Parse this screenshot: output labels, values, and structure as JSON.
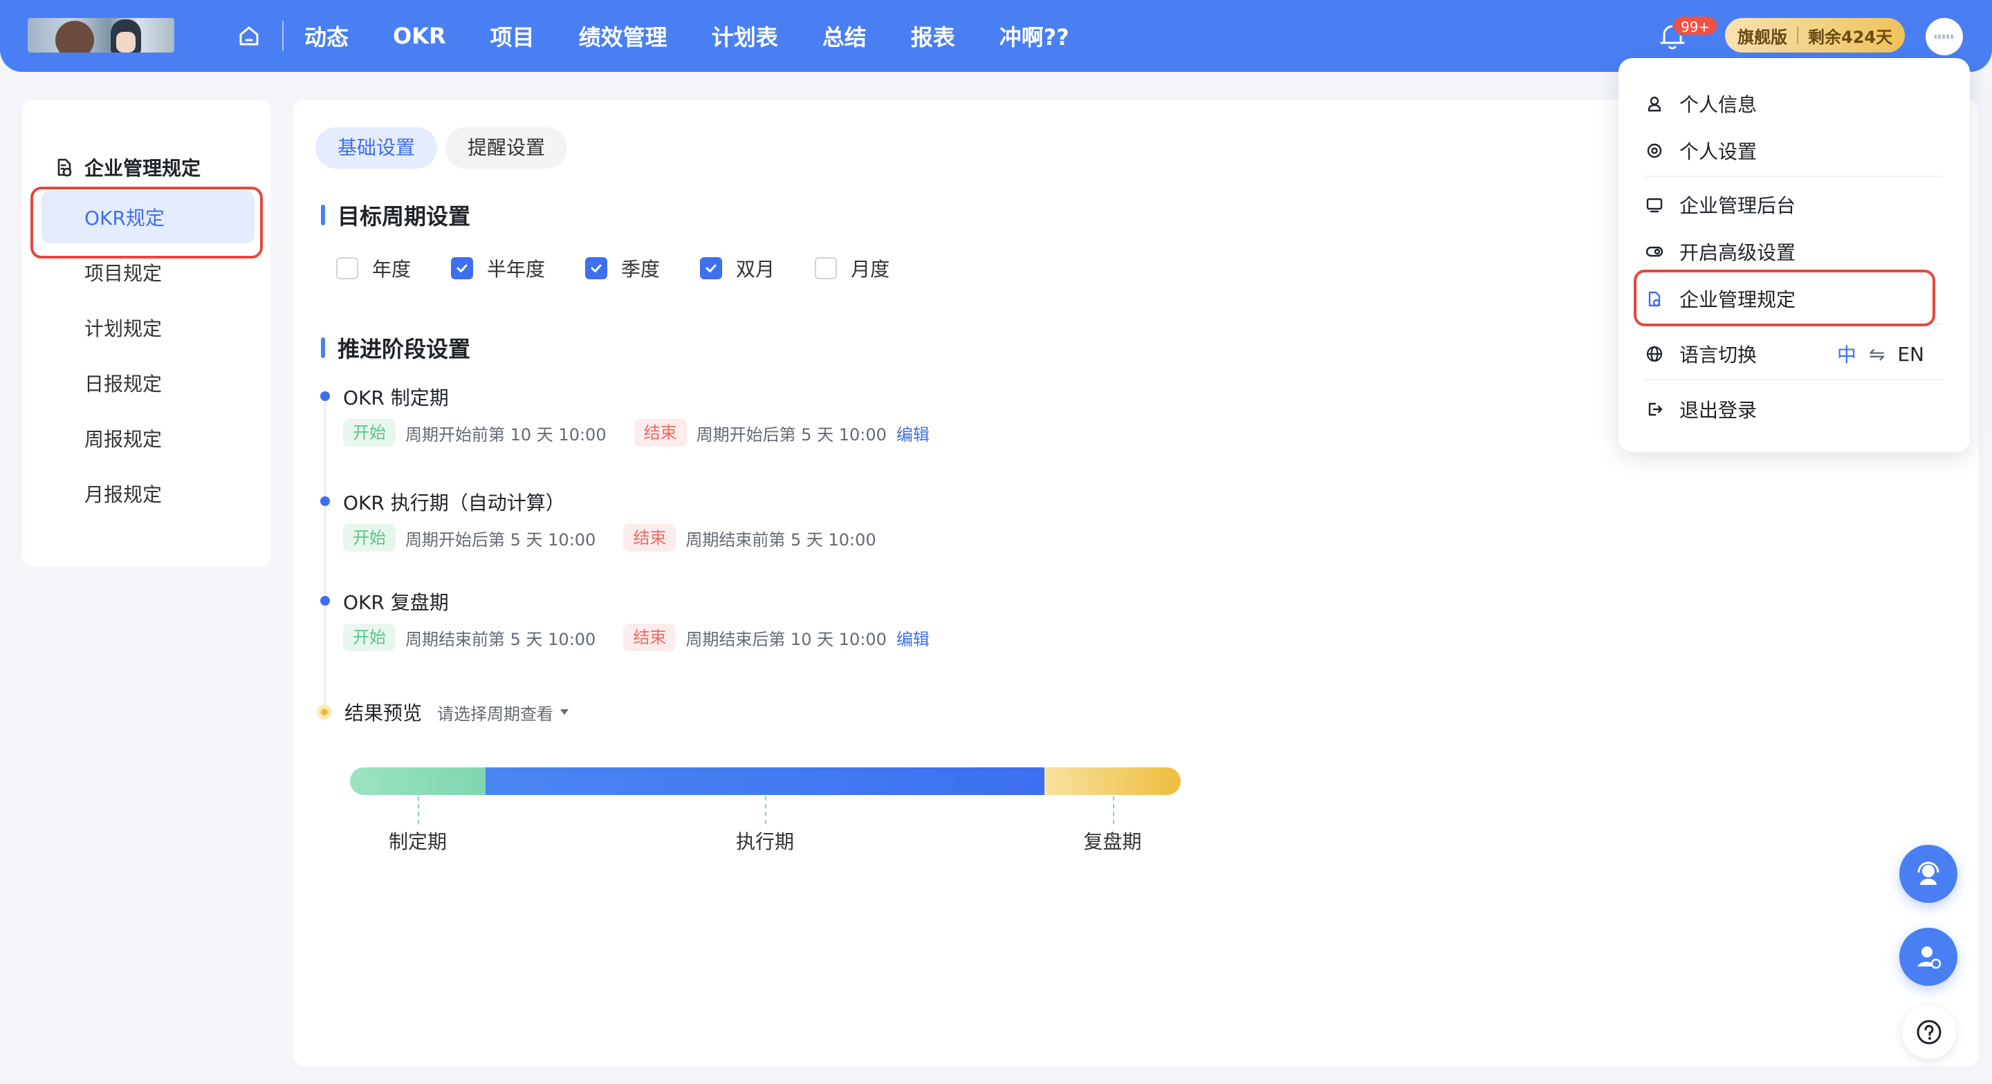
{
  "topnav": {
    "items": [
      "动态",
      "OKR",
      "项目",
      "绩效管理",
      "计划表",
      "总结",
      "报表",
      "冲啊??"
    ],
    "notification_count": "99+",
    "edition": "旗舰版",
    "remaining": "剩余424天"
  },
  "sidebar": {
    "heading": "企业管理规定",
    "items": [
      "OKR规定",
      "项目规定",
      "计划规定",
      "日报规定",
      "周报规定",
      "月报规定"
    ],
    "active_index": 0
  },
  "main": {
    "tabs": [
      "基础设置",
      "提醒设置"
    ],
    "active_tab": 0,
    "cycle_section_title": "目标周期设置",
    "cycles": [
      {
        "label": "年度",
        "checked": false
      },
      {
        "label": "半年度",
        "checked": true
      },
      {
        "label": "季度",
        "checked": true
      },
      {
        "label": "双月",
        "checked": true
      },
      {
        "label": "月度",
        "checked": false
      }
    ],
    "stage_section_title": "推进阶段设置",
    "stages": [
      {
        "name": "OKR 制定期",
        "start_tag": "开始",
        "start_rule": "周期开始前第 10 天 10:00",
        "end_tag": "结束",
        "end_rule": "周期开始后第 5 天 10:00",
        "edit": "编辑"
      },
      {
        "name": "OKR 执行期（自动计算）",
        "start_tag": "开始",
        "start_rule": "周期开始后第 5 天 10:00",
        "end_tag": "结束",
        "end_rule": "周期结束前第 5 天 10:00",
        "edit": ""
      },
      {
        "name": "OKR 复盘期",
        "start_tag": "开始",
        "start_rule": "周期结束前第 5 天 10:00",
        "end_tag": "结束",
        "end_rule": "周期结束后第 10 天 10:00",
        "edit": "编辑"
      }
    ],
    "preview": {
      "title": "结果预览",
      "hint": "请选择周期查看",
      "segments": [
        {
          "label": "制定期",
          "fraction": 0.163,
          "color_from": "#9be3c1",
          "color_to": "#7fd6b0"
        },
        {
          "label": "执行期",
          "fraction": 0.673,
          "color_from": "#4a86f2",
          "color_to": "#3d6ff0"
        },
        {
          "label": "复盘期",
          "fraction": 0.164,
          "color_from": "#f7e2a2",
          "color_to": "#edbd3d"
        }
      ]
    }
  },
  "menu": {
    "items": [
      "个人信息",
      "个人设置",
      "企业管理后台",
      "开启高级设置",
      "企业管理规定",
      "语言切换",
      "退出登录"
    ],
    "lang_zh": "中",
    "lang_switch": "⇋",
    "lang_en": "EN"
  },
  "colors": {
    "primary": "#4a7ff3",
    "highlight_box": "#e5483f"
  }
}
